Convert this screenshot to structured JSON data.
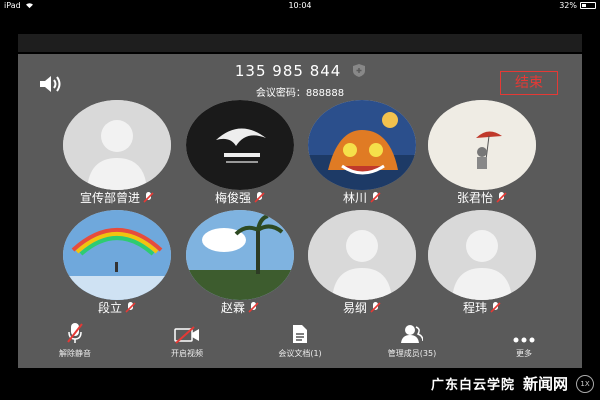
{
  "status_bar": {
    "device": "iPad",
    "time": "10:04",
    "battery": "32%",
    "wifi_icon": "wifi-icon"
  },
  "meeting": {
    "id": "135 985 844",
    "password": "会议密码：888888",
    "end_label": "结束",
    "accent": "#e53935"
  },
  "participants": [
    {
      "name": "宣传部曾进",
      "avatar": "default"
    },
    {
      "name": "梅俊强",
      "avatar": "logo-graffiti"
    },
    {
      "name": "林川",
      "avatar": "cartoon-cat"
    },
    {
      "name": "张君怡",
      "avatar": "umbrella-sketch"
    },
    {
      "name": "段立",
      "avatar": "rainbow-sky"
    },
    {
      "name": "赵霖",
      "avatar": "palm-trees"
    },
    {
      "name": "易纲",
      "avatar": "default"
    },
    {
      "name": "程玮",
      "avatar": "default"
    }
  ],
  "toolbar": {
    "unmute": "解除静音",
    "video": "开启视频",
    "docs": "会议文档(1)",
    "members": "管理成员(35)",
    "more": "更多"
  },
  "watermark": {
    "school": "广东白云学院",
    "news": "新闻网",
    "zoom": "1X"
  }
}
